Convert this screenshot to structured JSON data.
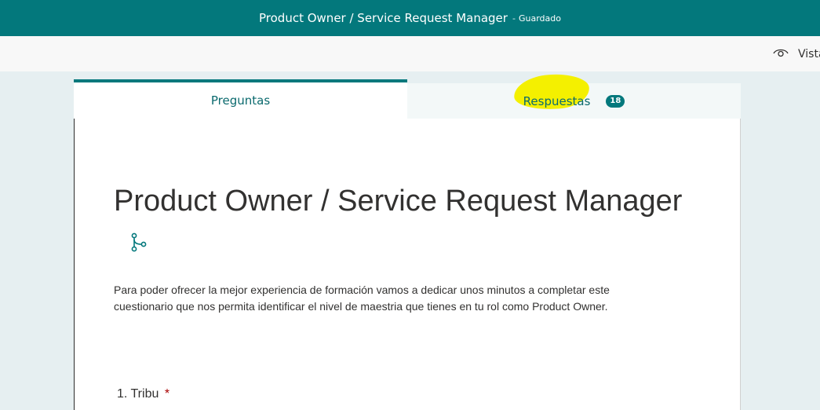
{
  "header": {
    "title": "Product Owner / Service Request Manager",
    "separator": "-",
    "save_status": "Guardado"
  },
  "toolbar": {
    "preview_label": "Vista",
    "preview_icon": "eye-icon"
  },
  "tabs": [
    {
      "label": "Preguntas",
      "selected": true
    },
    {
      "label": "Respuestas",
      "badge": "18",
      "selected": false
    }
  ],
  "form": {
    "title": "Product Owner / Service Request Manager",
    "branch_icon": "branching-icon",
    "description": "Para poder ofrecer la mejor experiencia de formación vamos a dedicar unos minutos a completar este cuestionario que nos permita identificar el nivel de maestria que tienes en tu rol como Product Owner.",
    "questions": [
      {
        "number": "1.",
        "label": "Tribu",
        "required_mark": "*"
      }
    ]
  },
  "colors": {
    "brand": "#03787c",
    "highlight": "#f4f000",
    "required": "#a80000"
  }
}
